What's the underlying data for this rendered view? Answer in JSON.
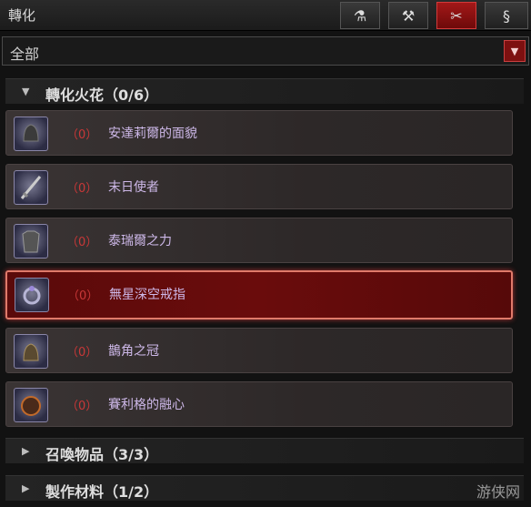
{
  "header": {
    "title": "轉化",
    "tabs": [
      {
        "icon": "flask-icon",
        "label": "⚗"
      },
      {
        "icon": "hammer-icon",
        "label": "⚒"
      },
      {
        "icon": "tools-icon",
        "label": "✂"
      },
      {
        "icon": "transform-icon",
        "label": "§"
      }
    ],
    "active_tab_index": 2
  },
  "filter": {
    "value": "全部",
    "arrow": "▼"
  },
  "sections": [
    {
      "name": "轉化火花",
      "count": "（0/6）",
      "expanded": true,
      "tri": "▼"
    },
    {
      "name": "召喚物品",
      "count": "（3/3）",
      "expanded": false,
      "tri": "▶"
    },
    {
      "name": "製作材料",
      "count": "（1/2）",
      "expanded": false,
      "tri": "▶"
    }
  ],
  "items": [
    {
      "qty": "（0）",
      "name": "安達莉爾的面貌",
      "selected": false
    },
    {
      "qty": "（0）",
      "name": "末日使者",
      "selected": false
    },
    {
      "qty": "（0）",
      "name": "泰瑞爾之力",
      "selected": false
    },
    {
      "qty": "（0）",
      "name": "無星深空戒指",
      "selected": true
    },
    {
      "qty": "（0）",
      "name": "鵲角之冠",
      "selected": false
    },
    {
      "qty": "（0）",
      "name": "賽利格的融心",
      "selected": false
    }
  ],
  "watermark": "游侠网"
}
